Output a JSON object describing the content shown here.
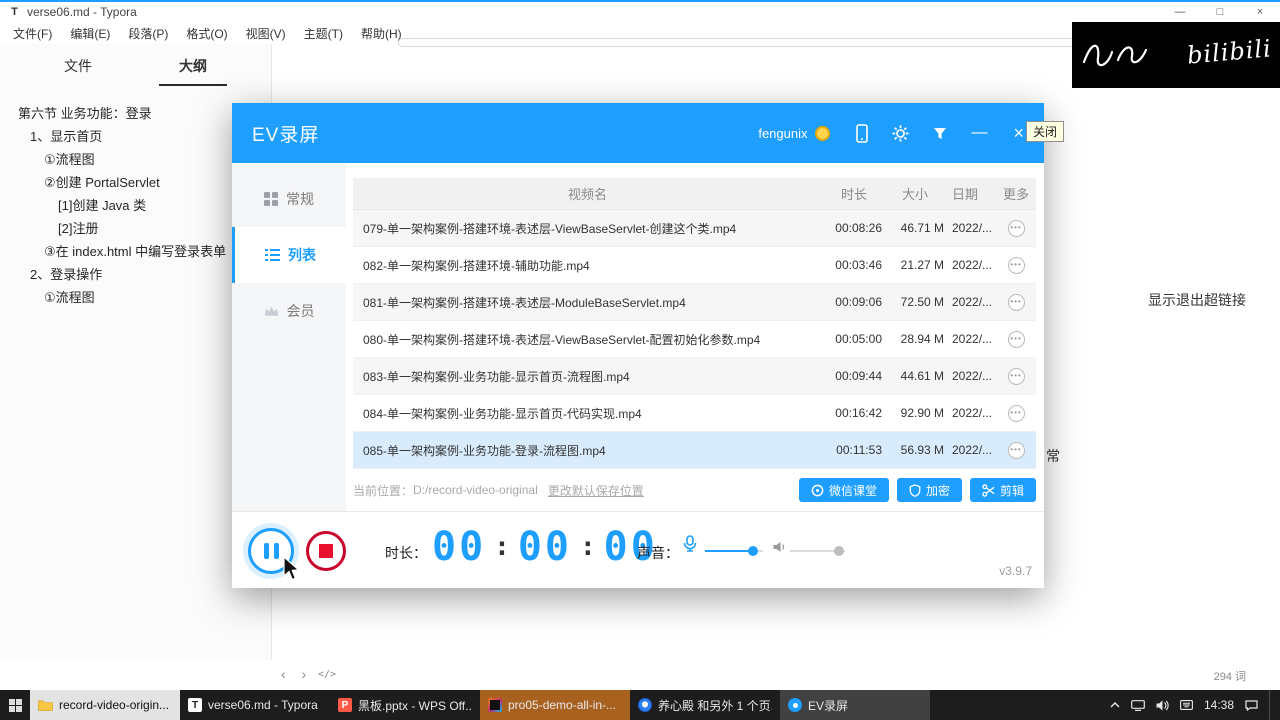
{
  "typora": {
    "app_icon": "T",
    "window_title": "verse06.md - Typora",
    "win_controls": {
      "minimize": "—",
      "maximize": "□",
      "close": "×"
    },
    "menu": [
      "文件(F)",
      "编辑(E)",
      "段落(P)",
      "格式(O)",
      "视图(V)",
      "主题(T)",
      "帮助(H)"
    ],
    "sidebar": {
      "tabs": [
        "文件",
        "大纲"
      ],
      "outline": [
        {
          "text": "第六节 业务功能：登录"
        },
        {
          "text": "1、显示首页"
        },
        {
          "text": "①流程图"
        },
        {
          "text": "②创建 PortalServlet"
        },
        {
          "text": "[1]创建 Java 类"
        },
        {
          "text": "[2]注册"
        },
        {
          "text": "③在 index.html 中编写登录表单"
        },
        {
          "text": "2、登录操作"
        },
        {
          "text": "①流程图"
        }
      ]
    },
    "editor_fragments": {
      "f1": "显示退出超链接",
      "f2": "常"
    },
    "statusbar": {
      "nav_arrows": "‹ ›",
      "source_icon": "</>",
      "word_count": "294 词"
    }
  },
  "watermark": {
    "text": "bilibili"
  },
  "ev": {
    "title": "EV录屏",
    "user": "fengunix",
    "close_tooltip": "关闭",
    "titlebar_controls": {
      "minimize": "—",
      "close": "×"
    },
    "nav": [
      {
        "label": "常规"
      },
      {
        "label": "列表"
      },
      {
        "label": "会员"
      }
    ],
    "table": {
      "headers": {
        "name": "视频名",
        "duration": "时长",
        "size": "大小",
        "date": "日期",
        "more": "更多"
      },
      "rows": [
        {
          "name": "079-单一架构案例-搭建环境-表述层-ViewBaseServlet-创建这个类.mp4",
          "duration": "00:08:26",
          "size": "46.71 M",
          "date": "2022/..."
        },
        {
          "name": "082-单一架构案例-搭建环境-辅助功能.mp4",
          "duration": "00:03:46",
          "size": "21.27 M",
          "date": "2022/..."
        },
        {
          "name": "081-单一架构案例-搭建环境-表述层-ModuleBaseServlet.mp4",
          "duration": "00:09:06",
          "size": "72.50 M",
          "date": "2022/..."
        },
        {
          "name": "080-单一架构案例-搭建环境-表述层-ViewBaseServlet-配置初始化参数.mp4",
          "duration": "00:05:00",
          "size": "28.94 M",
          "date": "2022/..."
        },
        {
          "name": "083-单一架构案例-业务功能-显示首页-流程图.mp4",
          "duration": "00:09:44",
          "size": "44.61 M",
          "date": "2022/..."
        },
        {
          "name": "084-单一架构案例-业务功能-显示首页-代码实现.mp4",
          "duration": "00:16:42",
          "size": "92.90 M",
          "date": "2022/..."
        },
        {
          "name": "085-单一架构案例-业务功能-登录-流程图.mp4",
          "duration": "00:11:53",
          "size": "56.93 M",
          "date": "2022/..."
        }
      ]
    },
    "location": {
      "label": "当前位置：",
      "path": "D:/record-video-original",
      "link": "更改默认保存位置"
    },
    "buttons": [
      {
        "label": "微信课堂"
      },
      {
        "label": "加密"
      },
      {
        "label": "剪辑"
      }
    ],
    "controls": {
      "duration_label": "时长：",
      "time_h": "00",
      "time_m": "00",
      "time_s": "00",
      "colon": ":",
      "sound_label": "声音：",
      "version": "v3.9.7"
    },
    "accent_color": "#1e9fff"
  },
  "taskbar": {
    "items": [
      {
        "label": "record-video-origin..."
      },
      {
        "label": "verse06.md - Typora"
      },
      {
        "label": "黑板.pptx - WPS Off..."
      },
      {
        "label": "pro05-demo-all-in-..."
      },
      {
        "label": "养心殿 和另外 1 个页..."
      },
      {
        "label": "EV录屏"
      }
    ],
    "time": "14:38"
  }
}
